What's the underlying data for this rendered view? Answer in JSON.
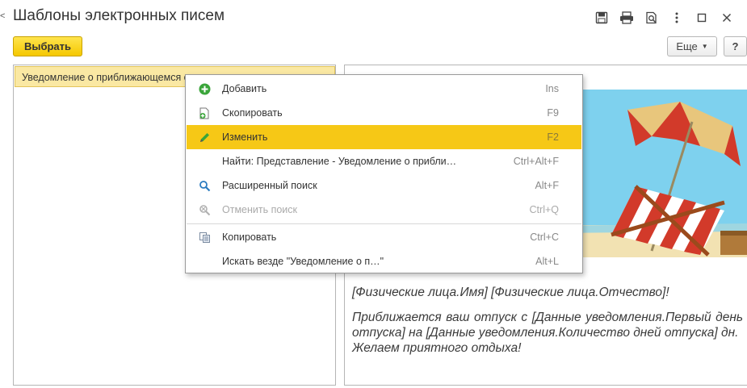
{
  "window": {
    "title": "Шаблоны электронных писем",
    "left_marker": "<"
  },
  "toolbar": {
    "choose_label": "Выбрать",
    "more_label": "Еще",
    "help_label": "?"
  },
  "list": {
    "rows": [
      {
        "label": "Уведомление о приближающемся отпуске"
      }
    ]
  },
  "context_menu": {
    "items": [
      {
        "label": "Добавить",
        "shortcut": "Ins",
        "icon": "add-icon",
        "state": "normal"
      },
      {
        "label": "Скопировать",
        "shortcut": "F9",
        "icon": "copy-item-icon",
        "state": "normal"
      },
      {
        "label": "Изменить",
        "shortcut": "F2",
        "icon": "pencil-icon",
        "state": "active"
      },
      {
        "label": "Найти: Представление - Уведомление о прибли…",
        "shortcut": "Ctrl+Alt+F",
        "icon": "",
        "state": "normal"
      },
      {
        "label": "Расширенный поиск",
        "shortcut": "Alt+F",
        "icon": "search-icon",
        "state": "normal"
      },
      {
        "label": "Отменить поиск",
        "shortcut": "Ctrl+Q",
        "icon": "cancel-search-icon",
        "state": "disabled"
      },
      {
        "label": "Копировать",
        "shortcut": "Ctrl+C",
        "icon": "clipboard-copy-icon",
        "state": "normal"
      },
      {
        "label": "Искать везде \"Уведомление о п…\"",
        "shortcut": "Alt+L",
        "icon": "",
        "state": "normal"
      }
    ]
  },
  "preview": {
    "line1": "[Физические лица.Имя] [Физические лица.Отчество]!",
    "line2": "Приближается ваш отпуск с [Данные уведомления.Первый день отпуска] на [Данные уведомления.Количество дней отпуска] дн.",
    "line3": "Желаем приятного отдыха!"
  },
  "colors": {
    "accent_yellow": "#f6c816",
    "selected_row": "#fae8a3",
    "add_green": "#3aa53a"
  }
}
